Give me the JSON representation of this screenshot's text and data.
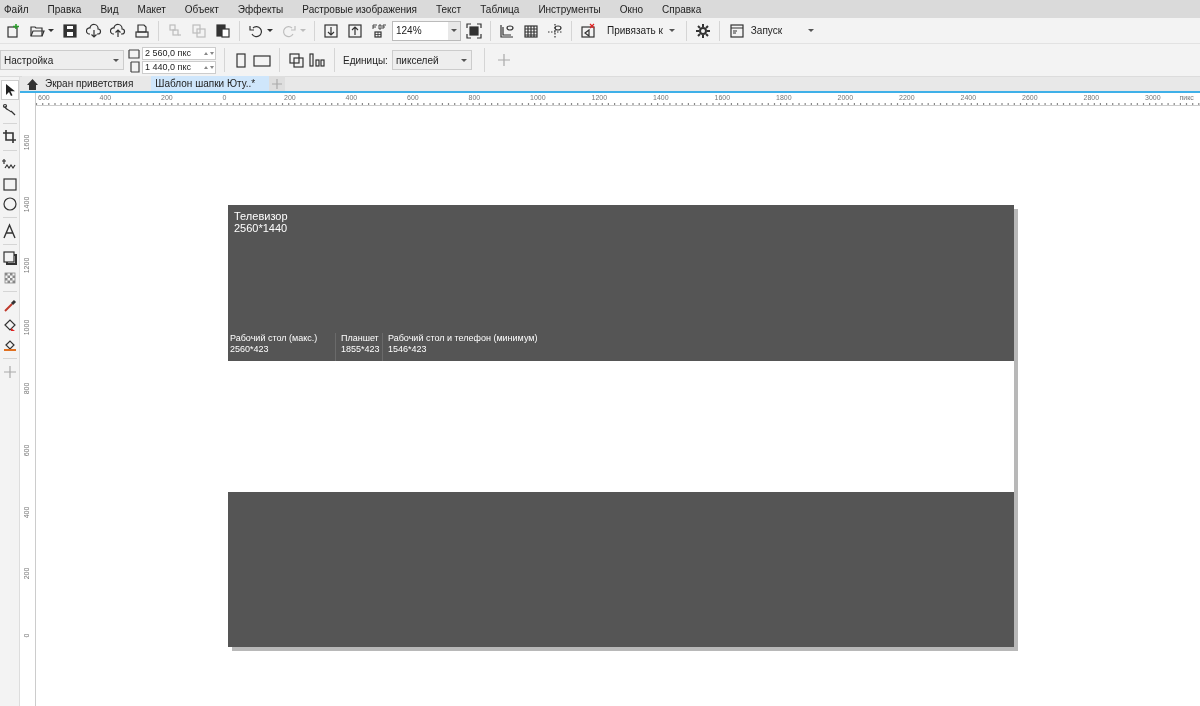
{
  "menu": [
    {
      "label": "Файл"
    },
    {
      "label": "Правка"
    },
    {
      "label": "Вид"
    },
    {
      "label": "Макет"
    },
    {
      "label": "Объект"
    },
    {
      "label": "Эффекты"
    },
    {
      "label": "Растровые изображения"
    },
    {
      "label": "Текст"
    },
    {
      "label": "Таблица"
    },
    {
      "label": "Инструменты"
    },
    {
      "label": "Окно"
    },
    {
      "label": "Справка"
    }
  ],
  "toolbar": [
    {
      "kind": "new",
      "disabled": false
    },
    {
      "kind": "open",
      "disabled": false
    },
    {
      "kind": "save",
      "disabled": false
    },
    {
      "kind": "cloud-down",
      "disabled": false
    },
    {
      "kind": "cloud-up",
      "disabled": false
    },
    {
      "kind": "print",
      "disabled": false
    },
    {
      "kind": "sep"
    },
    {
      "kind": "cut",
      "disabled": true
    },
    {
      "kind": "copy",
      "disabled": true
    },
    {
      "kind": "paste",
      "disabled": false
    },
    {
      "kind": "sep"
    },
    {
      "kind": "undo",
      "disabled": false
    },
    {
      "kind": "redo",
      "disabled": true
    },
    {
      "kind": "sep"
    },
    {
      "kind": "import",
      "disabled": false
    },
    {
      "kind": "export",
      "disabled": false
    },
    {
      "kind": "pdf",
      "disabled": false
    },
    {
      "kind": "zoom",
      "value": "124%"
    },
    {
      "kind": "fullscreen",
      "disabled": false
    },
    {
      "kind": "sep"
    },
    {
      "kind": "rulers",
      "disabled": false
    },
    {
      "kind": "grid",
      "disabled": false
    },
    {
      "kind": "guides",
      "disabled": false
    },
    {
      "kind": "sep"
    },
    {
      "kind": "snap-off",
      "disabled": false
    },
    {
      "kind": "snap",
      "label": "Привязать к"
    },
    {
      "kind": "sep"
    },
    {
      "kind": "gear",
      "disabled": false
    },
    {
      "kind": "sep"
    },
    {
      "kind": "launch",
      "label": "Запуск"
    }
  ],
  "property_bar": {
    "preset": "Настройка",
    "width": "2 560,0 пкс",
    "height": "1 440,0 пкс",
    "units_label": "Единицы:",
    "units": "пикселей"
  },
  "tabs": [
    {
      "label": "Экран приветствия",
      "selected": false,
      "kind": "home"
    },
    {
      "label": "Шаблон шапки Юту..*",
      "selected": true,
      "kind": "document"
    }
  ],
  "rulers": {
    "horizontal": [
      "600",
      "400",
      "200",
      "0",
      "200",
      "400",
      "600",
      "800",
      "1000",
      "1200",
      "1400",
      "1600",
      "1800",
      "2000",
      "2200",
      "2400",
      "2600",
      "2800",
      "3000"
    ],
    "unit": "пикс",
    "vertical": [
      "1600",
      "1400",
      "1200",
      "1000",
      "800",
      "600",
      "400",
      "200",
      "0"
    ]
  },
  "toolbox": [
    {
      "kind": "pick",
      "selected": true
    },
    {
      "kind": "shape",
      "selected": false
    },
    {
      "kind": "sep"
    },
    {
      "kind": "crop",
      "selected": false
    },
    {
      "kind": "sep"
    },
    {
      "kind": "freehand",
      "selected": false
    },
    {
      "kind": "rectangle",
      "selected": false
    },
    {
      "kind": "ellipse",
      "selected": false
    },
    {
      "kind": "sep"
    },
    {
      "kind": "text",
      "selected": false
    },
    {
      "kind": "sep"
    },
    {
      "kind": "shadow",
      "selected": false
    },
    {
      "kind": "transparency",
      "selected": false
    },
    {
      "kind": "sep"
    },
    {
      "kind": "eyedropper",
      "selected": false
    },
    {
      "kind": "fill",
      "selected": false
    },
    {
      "kind": "smart-fill",
      "selected": false
    },
    {
      "kind": "sep"
    },
    {
      "kind": "add",
      "selected": false
    }
  ],
  "document": {
    "title_lines": [
      "Телевизор",
      "2560*1440"
    ],
    "sections": [
      {
        "title": "Рабочий стол (макс.)",
        "size": "2560*423"
      },
      {
        "title": "Планшет",
        "size": "1855*423"
      },
      {
        "title": "Рабочий стол и телефон (минимум)",
        "size": "1546*423"
      }
    ]
  }
}
